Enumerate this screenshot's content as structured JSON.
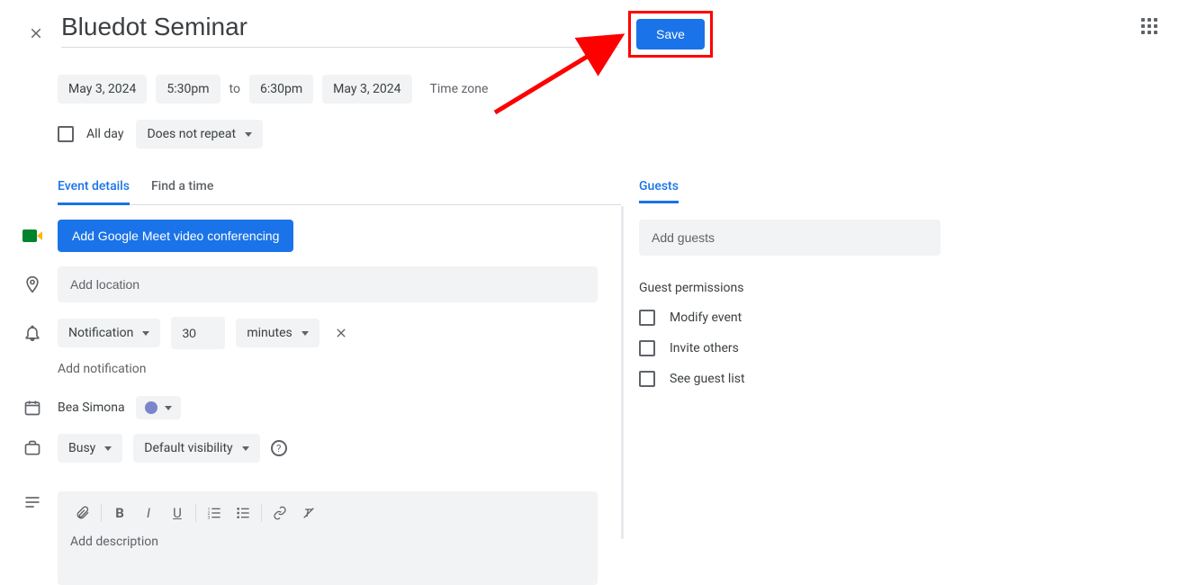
{
  "title": "Bluedot Seminar",
  "save_label": "Save",
  "date_start": "May 3, 2024",
  "time_start": "5:30pm",
  "to_label": "to",
  "time_end": "6:30pm",
  "date_end": "May 3, 2024",
  "timezone_label": "Time zone",
  "allday_label": "All day",
  "repeat_label": "Does not repeat",
  "tabs": {
    "event_details": "Event details",
    "find_time": "Find a time"
  },
  "meet_button": "Add Google Meet video conferencing",
  "location_placeholder": "Add location",
  "notification": {
    "type": "Notification",
    "value": "30",
    "unit": "minutes"
  },
  "add_notification": "Add notification",
  "owner_name": "Bea Simona",
  "availability": "Busy",
  "visibility": "Default visibility",
  "description_placeholder": "Add description",
  "guests": {
    "header": "Guests",
    "placeholder": "Add guests",
    "permissions_title": "Guest permissions",
    "perm_modify": "Modify event",
    "perm_invite": "Invite others",
    "perm_seelist": "See guest list"
  }
}
